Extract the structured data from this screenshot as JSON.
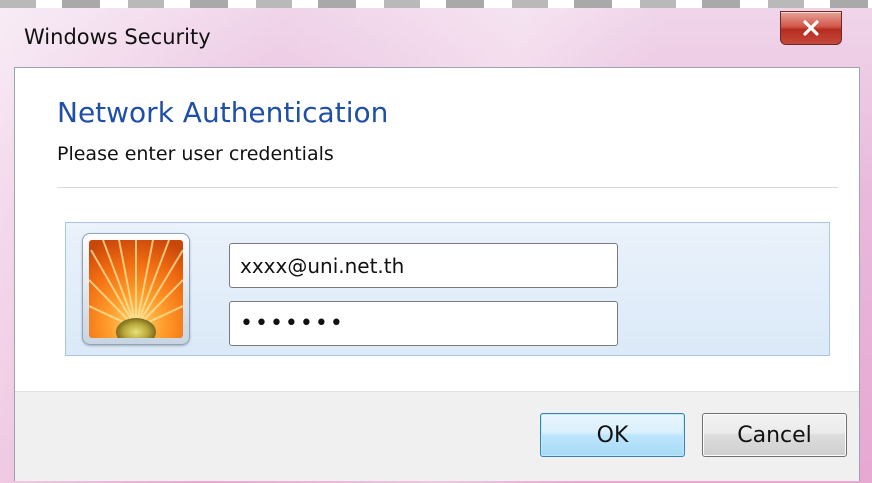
{
  "window": {
    "title": "Windows Security",
    "close_icon": "close-icon"
  },
  "dialog": {
    "heading": "Network Authentication",
    "subheading": "Please enter user credentials"
  },
  "credentials": {
    "avatar_icon": "user-tile-flower-icon",
    "username_value": "xxxx@uni.net.th",
    "password_value": "•••••••"
  },
  "buttons": {
    "ok_label": "OK",
    "cancel_label": "Cancel"
  },
  "colors": {
    "heading": "#1f4fa6",
    "close_button": "#c44a3c",
    "ok_border": "#3c7fb1"
  }
}
